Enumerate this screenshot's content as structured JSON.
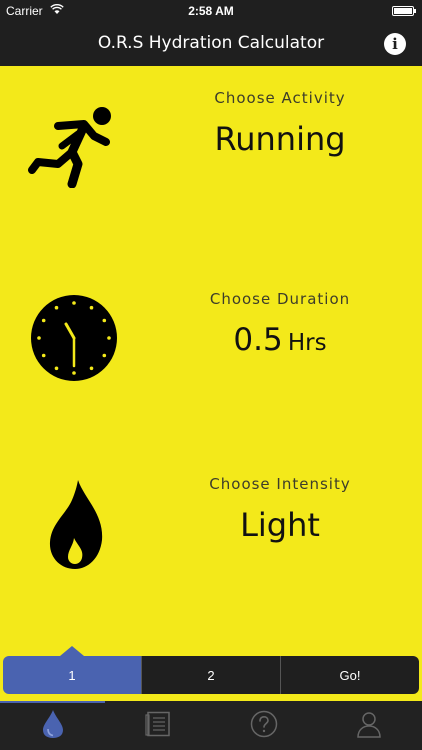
{
  "status": {
    "carrier": "Carrier",
    "time": "2:58 AM"
  },
  "nav": {
    "title": "O.R.S Hydration Calculator",
    "info_glyph": "i"
  },
  "rows": [
    {
      "label": "Choose Activity",
      "value": "Running",
      "icon": "running-person-icon"
    },
    {
      "label": "Choose Duration",
      "value_number": "0.5",
      "value_unit": "Hrs",
      "icon": "clock-icon"
    },
    {
      "label": "Choose Intensity",
      "value": "Light",
      "icon": "flame-icon"
    }
  ],
  "segments": [
    {
      "label": "1",
      "active": true
    },
    {
      "label": "2",
      "active": false
    },
    {
      "label": "Go!",
      "active": false
    }
  ],
  "tabs": [
    {
      "icon": "water-drop-icon",
      "active": true
    },
    {
      "icon": "list-icon",
      "active": false
    },
    {
      "icon": "help-icon",
      "active": false
    },
    {
      "icon": "profile-icon",
      "active": false
    }
  ],
  "colors": {
    "background": "#f3e91a",
    "bar": "#1f1f1f",
    "accent": "#4a63b0"
  }
}
